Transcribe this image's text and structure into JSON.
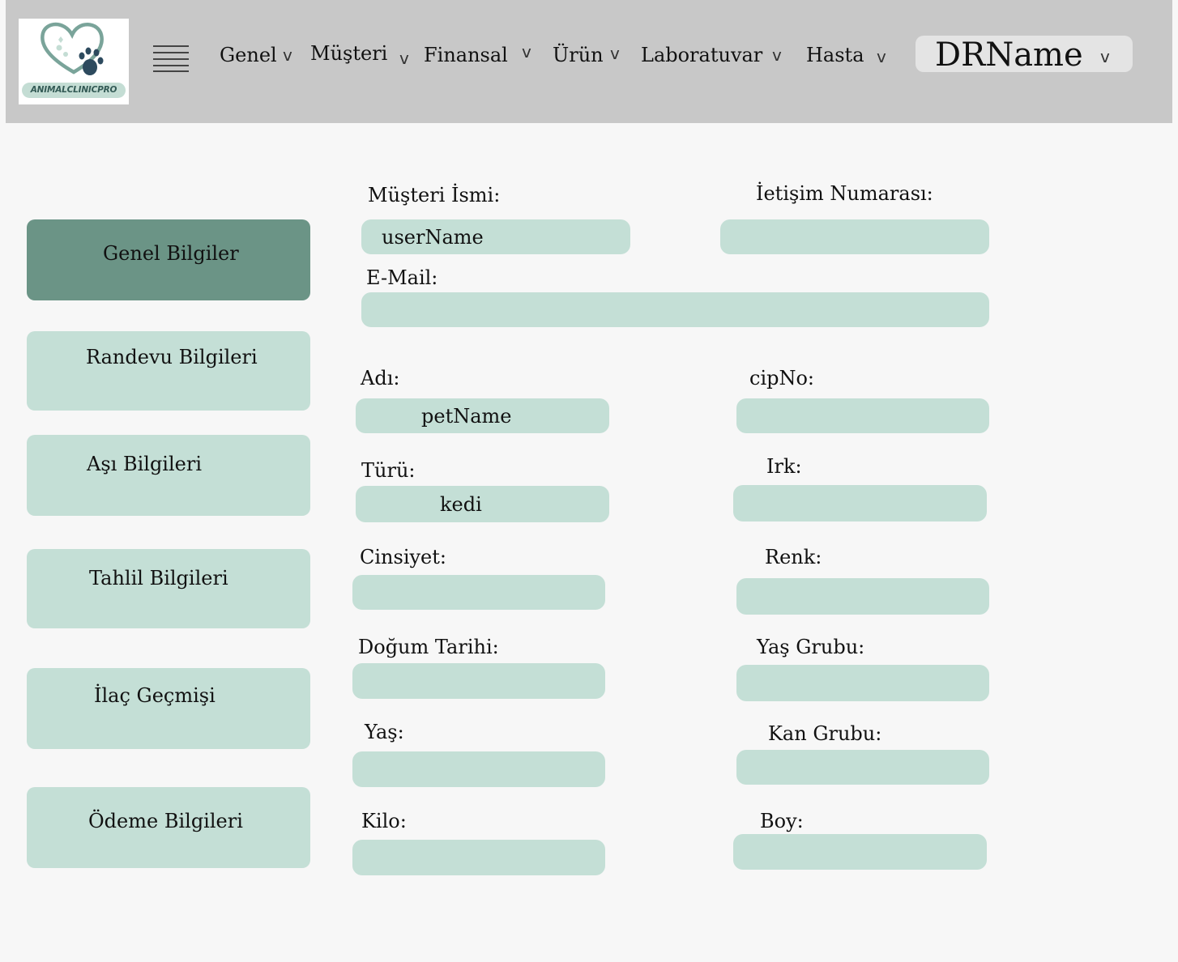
{
  "header": {
    "logo": {
      "text": "ANIMALCLINICPRO",
      "colors": {
        "heart": "#7aa49a",
        "paw": "#2d4a5e",
        "accent": "#c4ddd4"
      }
    },
    "menu_icon": "hamburger-icon",
    "nav": [
      {
        "label": "Genel"
      },
      {
        "label": "Müşteri"
      },
      {
        "label": "Finansal"
      },
      {
        "label": "Ürün"
      },
      {
        "label": "Laboratuvar"
      },
      {
        "label": "Hasta"
      }
    ],
    "chevron": "v",
    "user": {
      "name": "DRName"
    }
  },
  "sidebar": {
    "items": [
      {
        "label": "Genel Bilgiler",
        "active": true
      },
      {
        "label": "Randevu Bilgileri"
      },
      {
        "label": "Aşı Bilgileri"
      },
      {
        "label": "Tahlil Bilgileri"
      },
      {
        "label": "İlaç Geçmişi"
      },
      {
        "label": "Ödeme Bilgileri"
      }
    ]
  },
  "form": {
    "musteri_ismi": {
      "label": "Müşteri İsmi:",
      "value": "userName"
    },
    "iletisim": {
      "label": "İetişim Numarası:",
      "value": ""
    },
    "email": {
      "label": "E-Mail:",
      "value": ""
    },
    "adi": {
      "label": "Adı:",
      "value": "petName"
    },
    "cipno": {
      "label": "cipNo:",
      "value": ""
    },
    "turu": {
      "label": "Türü:",
      "value": "kedi"
    },
    "irk": {
      "label": "Irk:",
      "value": ""
    },
    "cinsiyet": {
      "label": "Cinsiyet:",
      "value": ""
    },
    "renk": {
      "label": "Renk:",
      "value": ""
    },
    "dogum_tarihi": {
      "label": "Doğum Tarihi:",
      "value": ""
    },
    "yas_grubu": {
      "label": "Yaş Grubu:",
      "value": ""
    },
    "yas": {
      "label": "Yaş:",
      "value": ""
    },
    "kan_grubu": {
      "label": "Kan Grubu:",
      "value": ""
    },
    "kilo": {
      "label": "Kilo:",
      "value": ""
    },
    "boy": {
      "label": "Boy:",
      "value": ""
    }
  },
  "colors": {
    "topbar": "#c8c8c8",
    "field": "#c4dfd6",
    "active_tab": "#6b9486",
    "background": "#f7f7f7"
  }
}
